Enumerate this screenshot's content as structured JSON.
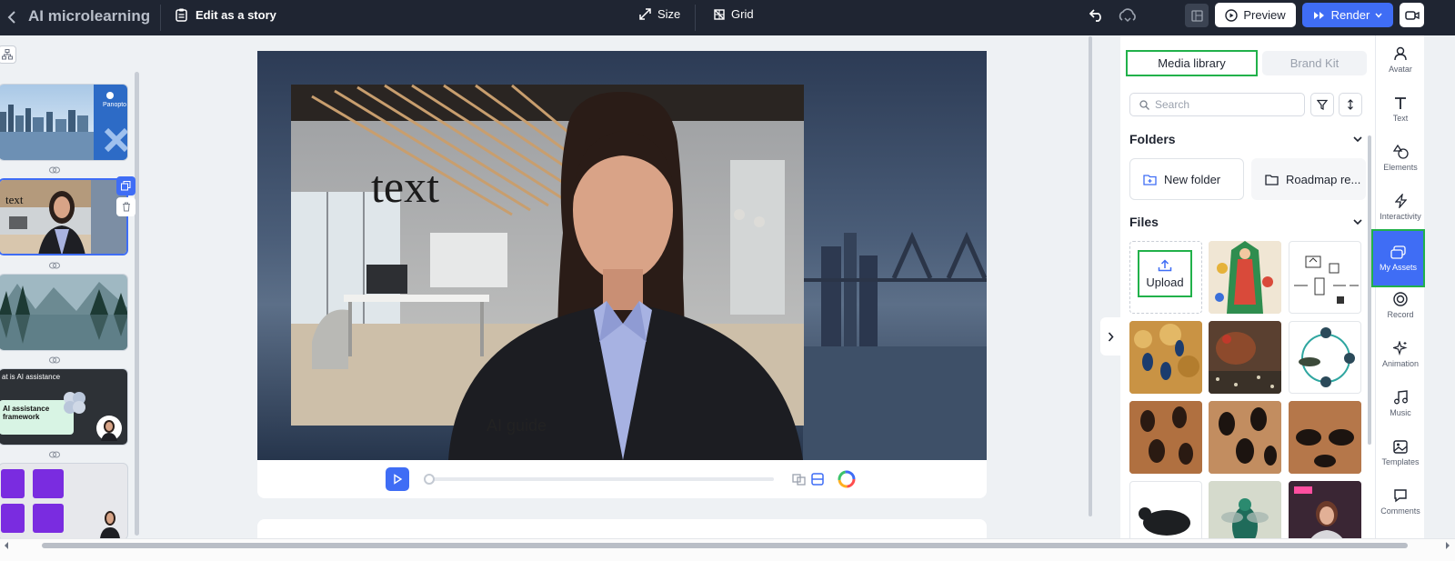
{
  "app": {
    "title": "AI microlearning",
    "edit_story_label": "Edit as a story"
  },
  "toolbar": {
    "size_label": "Size",
    "grid_label": "Grid",
    "preview_label": "Preview",
    "render_label": "Render"
  },
  "canvas": {
    "text_label": "text",
    "guide_label": "AI guide",
    "progress": 0
  },
  "slides": [
    {
      "label": ""
    },
    {
      "label": ""
    },
    {
      "label": ""
    },
    {
      "label": "at is AI assistance",
      "box_title": "AI assistance framework"
    },
    {
      "label": ""
    }
  ],
  "panel": {
    "tabs": [
      {
        "label": "Media library",
        "active": true
      },
      {
        "label": "Brand Kit",
        "active": false
      }
    ],
    "search_placeholder": "Search",
    "folders_title": "Folders",
    "folders": [
      {
        "label": "New folder"
      },
      {
        "label": "Roadmap re..."
      }
    ],
    "files_title": "Files",
    "upload_label": "Upload"
  },
  "rail": [
    {
      "label": "Avatar",
      "icon": "avatar-icon"
    },
    {
      "label": "Text",
      "icon": "text-icon"
    },
    {
      "label": "Elements",
      "icon": "elements-icon"
    },
    {
      "label": "Interactivity",
      "icon": "lightning-icon"
    },
    {
      "label": "My Assets",
      "icon": "assets-icon",
      "active": true
    },
    {
      "label": "Record",
      "icon": "record-icon"
    },
    {
      "label": "Animation",
      "icon": "sparkle-icon"
    },
    {
      "label": "Music",
      "icon": "music-icon"
    },
    {
      "label": "Templates",
      "icon": "image-icon"
    },
    {
      "label": "Comments",
      "icon": "comment-icon"
    }
  ],
  "colors": {
    "topbar": "#1f2532",
    "accent": "#3f6df5",
    "highlight": "#21b14a"
  }
}
